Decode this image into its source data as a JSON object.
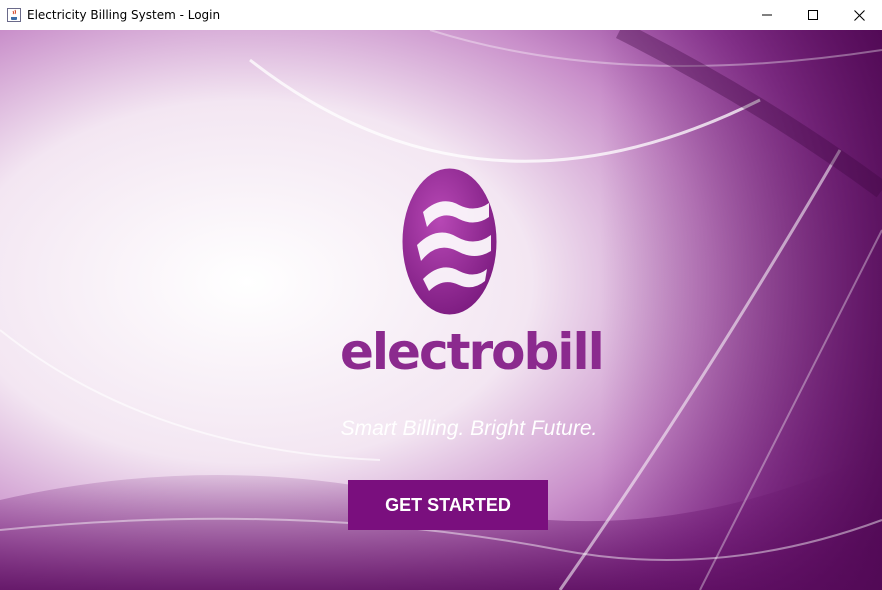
{
  "window": {
    "title": "Electricity Billing System - Login",
    "controls": [
      "minimize",
      "maximize",
      "close"
    ]
  },
  "brand": {
    "name": "electrobill",
    "tagline": "Smart Billing. Bright Future.",
    "logo_icon": "wave-logo-icon"
  },
  "actions": {
    "get_started_label": "GET STARTED"
  },
  "colors": {
    "brand_purple": "#8b2a8e",
    "button_purple": "#7a0f7e",
    "background_light": "#ffffff",
    "background_dark": "#5e0f62"
  }
}
